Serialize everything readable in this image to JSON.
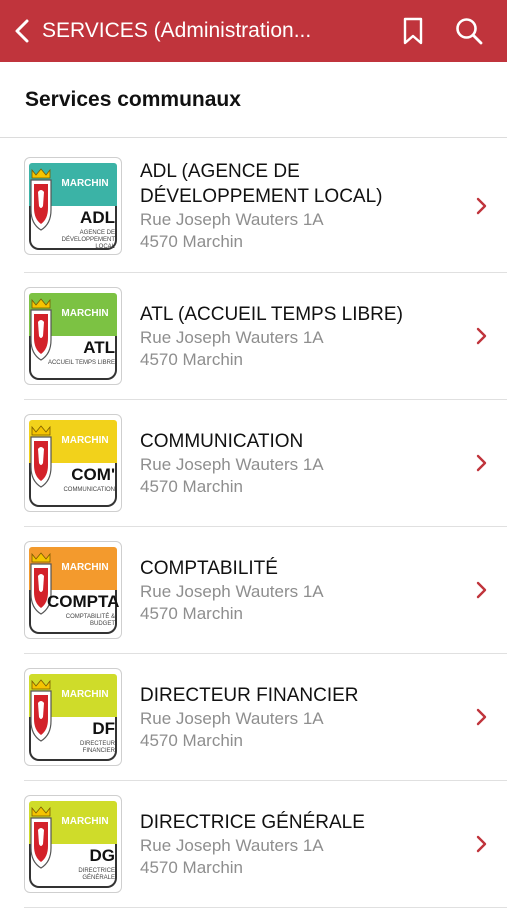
{
  "header": {
    "title": "SERVICES (Administration...",
    "bar_color": "#c0343c"
  },
  "section": {
    "title": "Services communaux"
  },
  "items": [
    {
      "name": "ADL (AGENCE DE DÉVELOPPEMENT LOCAL)",
      "street": "Rue Joseph Wauters 1A",
      "city": "4570 Marchin",
      "logo_commune": "MARCHIN",
      "logo_abbr": "ADL",
      "logo_sub": "AGENCE DE DÉVELOPPEMENT LOCAL",
      "logo_color": "#3bb3a6"
    },
    {
      "name": "ATL (ACCUEIL TEMPS LIBRE)",
      "street": "Rue Joseph Wauters 1A",
      "city": "4570 Marchin",
      "logo_commune": "MARCHIN",
      "logo_abbr": "ATL",
      "logo_sub": "ACCUEIL TEMPS LIBRE",
      "logo_color": "#7cc243"
    },
    {
      "name": "COMMUNICATION",
      "street": "Rue Joseph Wauters 1A",
      "city": "4570 Marchin",
      "logo_commune": "MARCHIN",
      "logo_abbr": "COM'",
      "logo_sub": "COMMUNICATION",
      "logo_color": "#f2d21b"
    },
    {
      "name": "COMPTABILITÉ",
      "street": "Rue Joseph Wauters 1A",
      "city": "4570 Marchin",
      "logo_commune": "MARCHIN",
      "logo_abbr": "COMPTA",
      "logo_sub": "COMPTABILITÉ & BUDGET",
      "logo_color": "#f39a2d"
    },
    {
      "name": "DIRECTEUR FINANCIER",
      "street": "Rue Joseph Wauters 1A",
      "city": "4570 Marchin",
      "logo_commune": "MARCHIN",
      "logo_abbr": "DF",
      "logo_sub": "DIRECTEUR FINANCIER",
      "logo_color": "#cfdc2a"
    },
    {
      "name": "DIRECTRICE GÉNÉRALE",
      "street": "Rue Joseph Wauters 1A",
      "city": "4570 Marchin",
      "logo_commune": "MARCHIN",
      "logo_abbr": "DG",
      "logo_sub": "DIRECTRICE GÉNÉRALE",
      "logo_color": "#cfdc2a"
    }
  ],
  "icons": {
    "back": "chevron-left-icon",
    "bookmark": "bookmark-icon",
    "search": "search-icon",
    "row_chevron": "chevron-right-icon"
  }
}
